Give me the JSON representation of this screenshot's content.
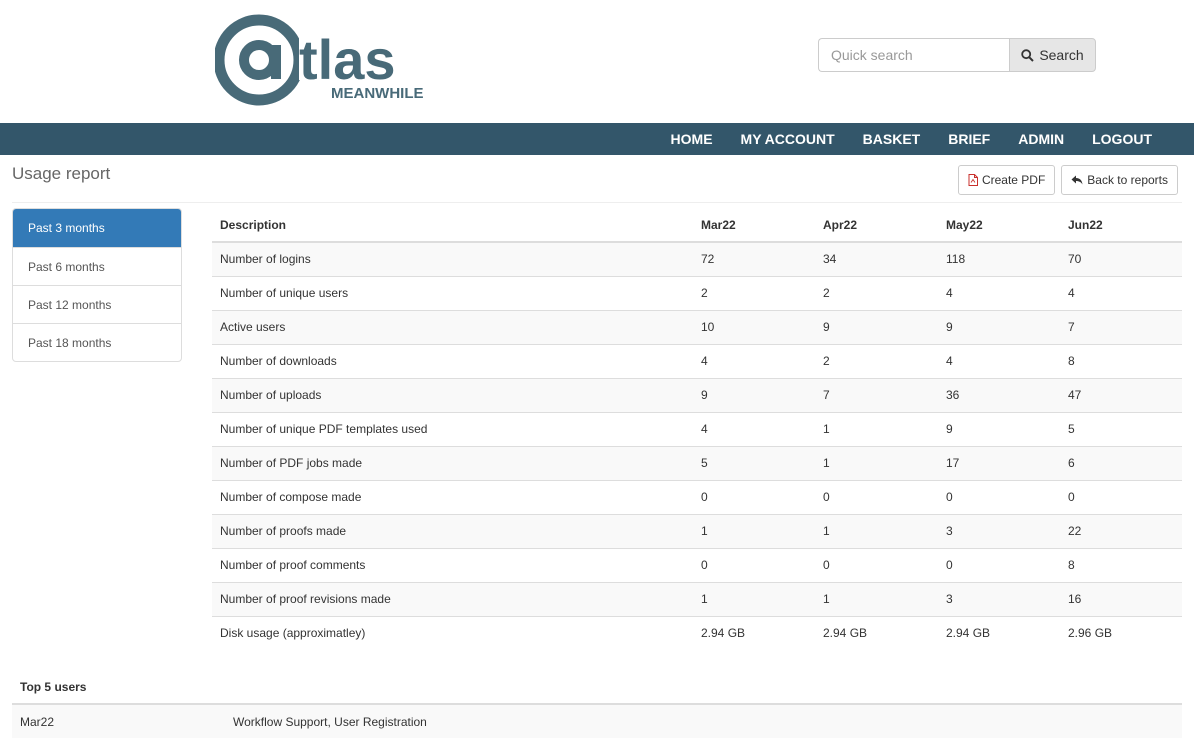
{
  "brand": {
    "logo_text": "@tlas",
    "logo_subtext": "MEANWHILE",
    "color": "#486a78"
  },
  "search": {
    "placeholder": "Quick search",
    "button_label": "Search"
  },
  "nav": [
    "HOME",
    "MY ACCOUNT",
    "BASKET",
    "BRIEF",
    "ADMIN",
    "LOGOUT"
  ],
  "page": {
    "title": "Usage report"
  },
  "actions": {
    "create_pdf": "Create PDF",
    "back": "Back to reports"
  },
  "periods": [
    "Past 3 months",
    "Past 6 months",
    "Past 12 months",
    "Past 18 months"
  ],
  "periods_active": 0,
  "report": {
    "headers": [
      "Description",
      "Mar22",
      "Apr22",
      "May22",
      "Jun22"
    ],
    "rows": [
      [
        "Number of logins",
        "72",
        "34",
        "118",
        "70"
      ],
      [
        "Number of unique users",
        "2",
        "2",
        "4",
        "4"
      ],
      [
        "Active users",
        "10",
        "9",
        "9",
        "7"
      ],
      [
        "Number of downloads",
        "4",
        "2",
        "4",
        "8"
      ],
      [
        "Number of uploads",
        "9",
        "7",
        "36",
        "47"
      ],
      [
        "Number of unique PDF templates used",
        "4",
        "1",
        "9",
        "5"
      ],
      [
        "Number of PDF jobs made",
        "5",
        "1",
        "17",
        "6"
      ],
      [
        "Number of compose made",
        "0",
        "0",
        "0",
        "0"
      ],
      [
        "Number of proofs made",
        "1",
        "1",
        "3",
        "22"
      ],
      [
        "Number of proof comments",
        "0",
        "0",
        "0",
        "8"
      ],
      [
        "Number of proof revisions made",
        "1",
        "1",
        "3",
        "16"
      ],
      [
        "Disk usage (approximatley)",
        "2.94 GB",
        "2.94 GB",
        "2.94 GB",
        "2.96 GB"
      ]
    ]
  },
  "top_users": {
    "title": "Top 5 users",
    "rows": [
      [
        "Mar22",
        "Workflow Support, User Registration"
      ]
    ]
  }
}
